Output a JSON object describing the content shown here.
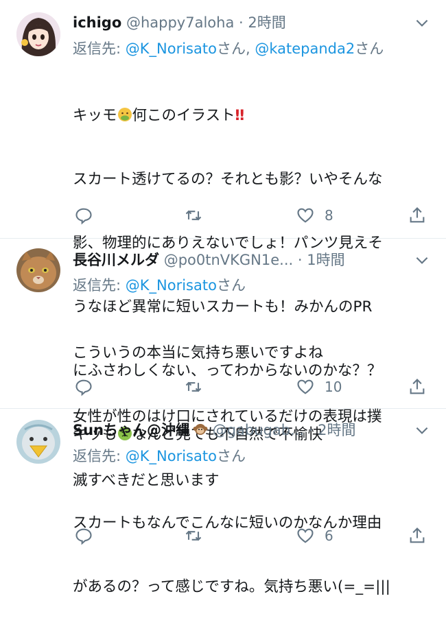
{
  "tweets": [
    {
      "name": "ichigo",
      "handle": "@happy7aloha",
      "time": "2時間",
      "reply_prefix": "返信先: ",
      "mentions": [
        "@K_Norisato",
        "@katepanda2"
      ],
      "mention_suffix": "さん",
      "mention_sep": "さん, ",
      "body_lines": [
        "キッモ",
        "何このイラスト",
        "スカート透けてるの？それとも影？いやそんな",
        "影、物理的にありえないでしょ！パンツ見えそ",
        "うなほど異常に短いスカートも！みかんのPR",
        "にふさわしくない、ってわからないのかな？？",
        "キッも",
        "なんど見ても不自然で不愉快"
      ],
      "emoji_1": "nauseated-face",
      "emoji_2": "sick-face",
      "exclaim": "‼",
      "likes": "8"
    },
    {
      "name": "長谷川メルダ",
      "handle": "@po0tnVKGN1e...",
      "time": "1時間",
      "reply_prefix": "返信先: ",
      "mentions": [
        "@K_Norisato"
      ],
      "mention_suffix": "さん",
      "body_lines": [
        "こういうの本当に気持ち悪いですよね",
        "女性が性のはけ口にされているだけの表現は撲",
        "滅すべきだと思います"
      ],
      "likes": "10"
    },
    {
      "name": "Sunちゃん@沖縄",
      "handle": "@gabugab...",
      "time": "2時間",
      "reply_prefix": "返信先: ",
      "mentions": [
        "@K_Norisato"
      ],
      "mention_suffix": "さん",
      "body_lines": [
        "スカートもなんでこんなに短いのかなんか理由",
        "があるの？って感じですね。気持ち悪い(=_=|||"
      ],
      "name_emoji": "monkey",
      "likes": "6"
    }
  ],
  "separator": " · ",
  "colors": {
    "accent": "#1b95e0",
    "muted": "#657786",
    "text": "#14171a",
    "border": "#e6ecf0"
  }
}
